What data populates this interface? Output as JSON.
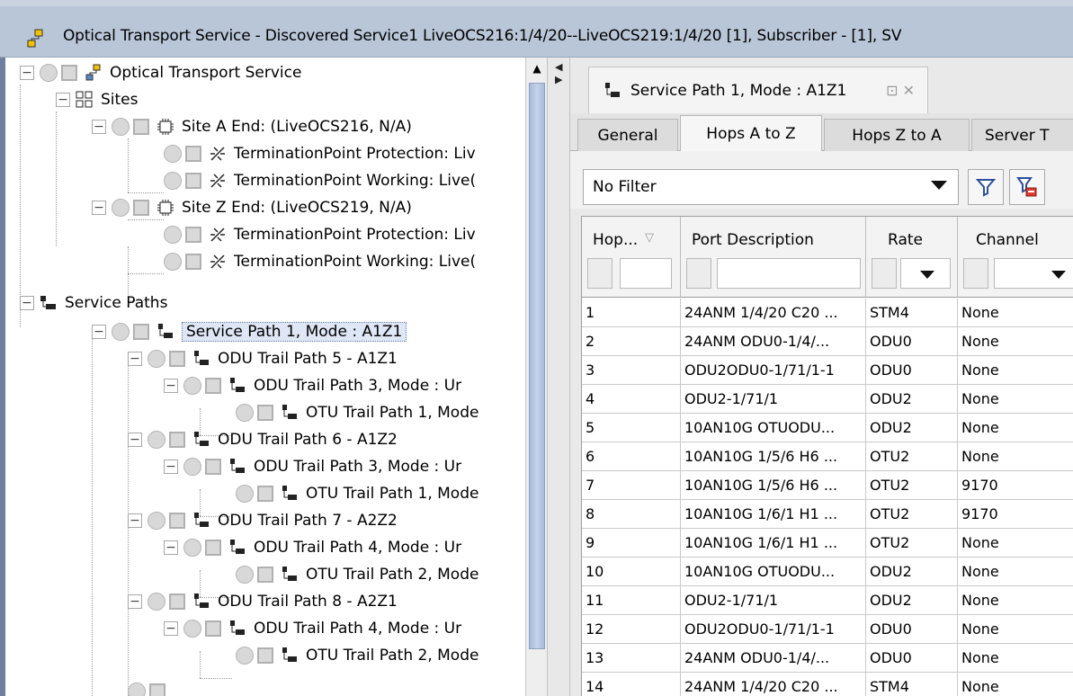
{
  "window": {
    "title": "Optical Transport Service - Discovered Service1 LiveOCS216:1/4/20--LiveOCS219:1/4/20 [1], Subscriber - [1], SV"
  },
  "tree": {
    "root": "Optical Transport Service",
    "sites": "Sites",
    "site_a": "Site A End: (LiveOCS216, N/A)",
    "site_a_tp1": "TerminationPoint Protection: Liv",
    "site_a_tp2": "TerminationPoint Working: Live(",
    "site_z": "Site Z End: (LiveOCS219, N/A)",
    "site_z_tp1": "TerminationPoint Protection: Liv",
    "site_z_tp2": "TerminationPoint Working: Live(",
    "service_paths": "Service Paths",
    "sp1": "Service Path 1, Mode : A1Z1",
    "odu5": "ODU Trail Path 5 - A1Z1",
    "odu5_c": "ODU Trail Path 3, Mode : Ur",
    "odu5_cc": "OTU Trail Path 1, Mode",
    "odu6": "ODU Trail Path 6 - A1Z2",
    "odu6_c": "ODU Trail Path 3, Mode : Ur",
    "odu6_cc": "OTU Trail Path 1, Mode",
    "odu7": "ODU Trail Path 7 - A2Z2",
    "odu7_c": "ODU Trail Path 4, Mode : Ur",
    "odu7_cc": "OTU Trail Path 2, Mode",
    "odu8": "ODU Trail Path 8 - A2Z1",
    "odu8_c": "ODU Trail Path 4, Mode : Ur",
    "odu8_cc": "OTU Trail Path 2, Mode"
  },
  "right": {
    "doc_tab": "Service Path 1, Mode : A1Z1",
    "tabs": [
      "General",
      "Hops A to Z",
      "Hops Z to A",
      "Server T"
    ],
    "filter": "No Filter"
  },
  "table": {
    "columns": [
      "Hop...",
      "Port Description",
      "Rate",
      "Channel"
    ],
    "rows": [
      [
        "1",
        "24ANM 1/4/20 C20 ...",
        "STM4",
        "None"
      ],
      [
        "2",
        "24ANM ODU0-1/4/...",
        "ODU0",
        "None"
      ],
      [
        "3",
        "ODU2ODU0-1/71/1-1",
        "ODU0",
        "None"
      ],
      [
        "4",
        "ODU2-1/71/1",
        "ODU2",
        "None"
      ],
      [
        "5",
        "10AN10G OTUODU...",
        "ODU2",
        "None"
      ],
      [
        "6",
        "10AN10G 1/5/6 H6 ...",
        "OTU2",
        "None"
      ],
      [
        "7",
        "10AN10G 1/5/6 H6 ...",
        "OTU2",
        "9170"
      ],
      [
        "8",
        "10AN10G 1/6/1 H1 ...",
        "OTU2",
        "9170"
      ],
      [
        "9",
        "10AN10G 1/6/1 H1 ...",
        "OTU2",
        "None"
      ],
      [
        "10",
        "10AN10G OTUODU...",
        "ODU2",
        "None"
      ],
      [
        "11",
        "ODU2-1/71/1",
        "ODU2",
        "None"
      ],
      [
        "12",
        "ODU2ODU0-1/71/1-1",
        "ODU0",
        "None"
      ],
      [
        "13",
        "24ANM ODU0-1/4/...",
        "ODU0",
        "None"
      ],
      [
        "14",
        "24ANM 1/4/20 C20 ...",
        "STM4",
        "None"
      ]
    ]
  }
}
